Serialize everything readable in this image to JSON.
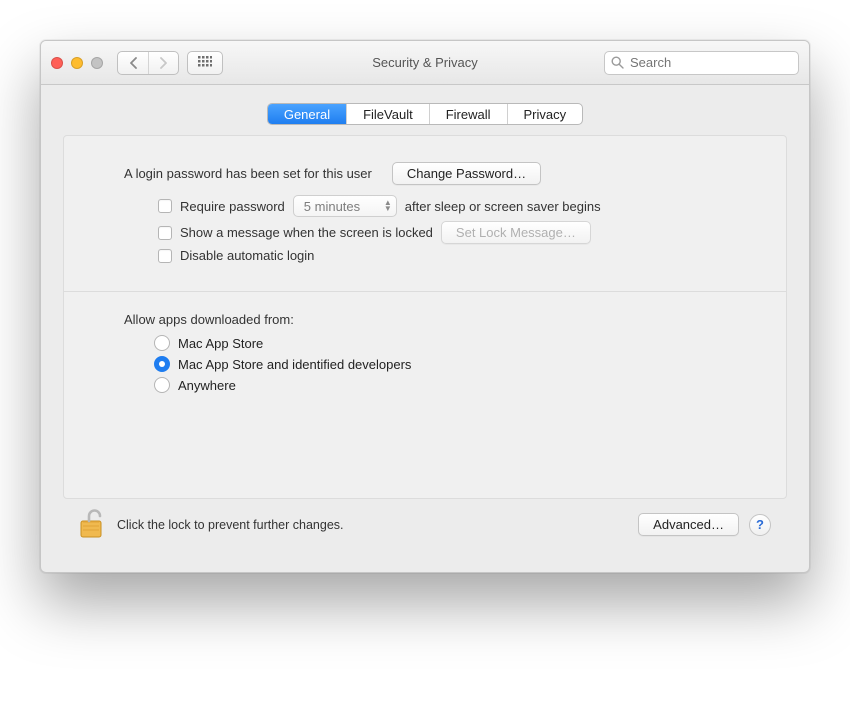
{
  "window": {
    "title": "Security & Privacy",
    "search_placeholder": "Search"
  },
  "tabs": {
    "items": [
      "General",
      "FileVault",
      "Firewall",
      "Privacy"
    ],
    "selected_index": 0
  },
  "general": {
    "password_set_text": "A login password has been set for this user",
    "change_password_label": "Change Password…",
    "require_password": {
      "checked": false,
      "prefix_label": "Require password",
      "delay_value": "5 minutes",
      "suffix_label": "after sleep or screen saver begins"
    },
    "lock_message": {
      "checked": false,
      "label": "Show a message when the screen is locked",
      "button_label": "Set Lock Message…",
      "button_enabled": false
    },
    "disable_auto_login": {
      "checked": false,
      "label": "Disable automatic login"
    },
    "allow_apps": {
      "title": "Allow apps downloaded from:",
      "options": [
        "Mac App Store",
        "Mac App Store and identified developers",
        "Anywhere"
      ],
      "selected_index": 1
    }
  },
  "footer": {
    "lock_text": "Click the lock to prevent further changes.",
    "lock_state": "unlocked",
    "advanced_label": "Advanced…",
    "help_label": "?"
  }
}
